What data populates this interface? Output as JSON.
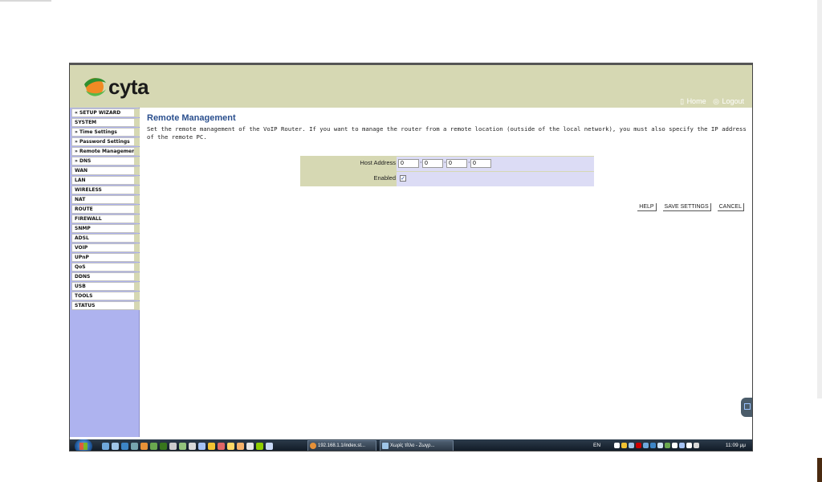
{
  "header": {
    "logo_text": "cyta",
    "home_link": "Home",
    "logout_link": "Logout"
  },
  "sidebar": {
    "items": [
      {
        "label": "« SETUP WIZARD"
      },
      {
        "label": "SYSTEM"
      },
      {
        "label": "» Time Settings"
      },
      {
        "label": "» Password Settings"
      },
      {
        "label": "» Remote Management"
      },
      {
        "label": "» DNS"
      },
      {
        "label": "WAN"
      },
      {
        "label": "LAN"
      },
      {
        "label": "WIRELESS"
      },
      {
        "label": "NAT"
      },
      {
        "label": "ROUTE"
      },
      {
        "label": "FIREWALL"
      },
      {
        "label": "SNMP"
      },
      {
        "label": "ADSL"
      },
      {
        "label": "VOIP"
      },
      {
        "label": "UPnP"
      },
      {
        "label": "QoS"
      },
      {
        "label": "DDNS"
      },
      {
        "label": "USB"
      },
      {
        "label": "TOOLS"
      },
      {
        "label": "STATUS"
      }
    ]
  },
  "main": {
    "title": "Remote Management",
    "description": "Set the remote management of the VoIP Router. If you want to manage the router from a remote location (outside of the local network), you must also specify the IP address of the remote PC.",
    "host_address_label": "Host Address",
    "host_address": [
      "0",
      "0",
      "0",
      "0"
    ],
    "enabled_label": "Enabled",
    "enabled_checked": true,
    "checkbox_glyph": "✓",
    "help_button": "HELP",
    "save_button": "SAVE SETTINGS",
    "cancel_button": "CANCEL"
  },
  "taskbar": {
    "tasks": [
      "192.168.1.1/index.st...",
      "Χωρίς τίτλο - Ζωγρ..."
    ],
    "language": "EN",
    "clock": "11:09 μμ"
  },
  "colors": {
    "header_bg": "#d6d8b3",
    "sidebar_bg": "#aeb3ef",
    "title_color": "#2a4f8e",
    "form_value_bg": "#dcdcf5"
  }
}
